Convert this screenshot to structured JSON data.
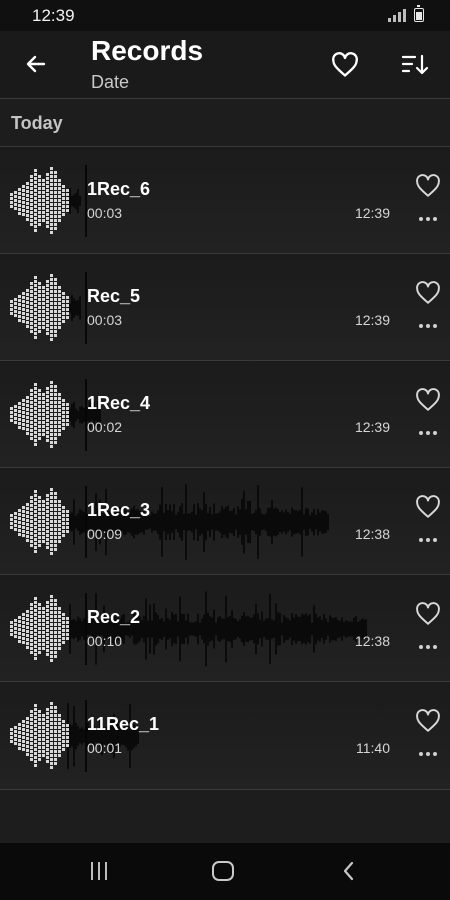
{
  "status_bar": {
    "time": "12:39"
  },
  "app_bar": {
    "title": "Records",
    "subtitle": "Date"
  },
  "section": {
    "header": "Today"
  },
  "colors": {
    "background": "#1d1d1d",
    "waveform": "#000000",
    "thumb": "#d8d8d8"
  },
  "records": [
    {
      "name": "1Rec_6",
      "duration": "00:03",
      "time": "12:39"
    },
    {
      "name": "Rec_5",
      "duration": "00:03",
      "time": "12:39"
    },
    {
      "name": "1Rec_4",
      "duration": "00:02",
      "time": "12:39"
    },
    {
      "name": "1Rec_3",
      "duration": "00:09",
      "time": "12:38"
    },
    {
      "name": "Rec_2",
      "duration": "00:10",
      "time": "12:38"
    },
    {
      "name": "11Rec_1",
      "duration": "00:01",
      "time": "11:40"
    }
  ]
}
